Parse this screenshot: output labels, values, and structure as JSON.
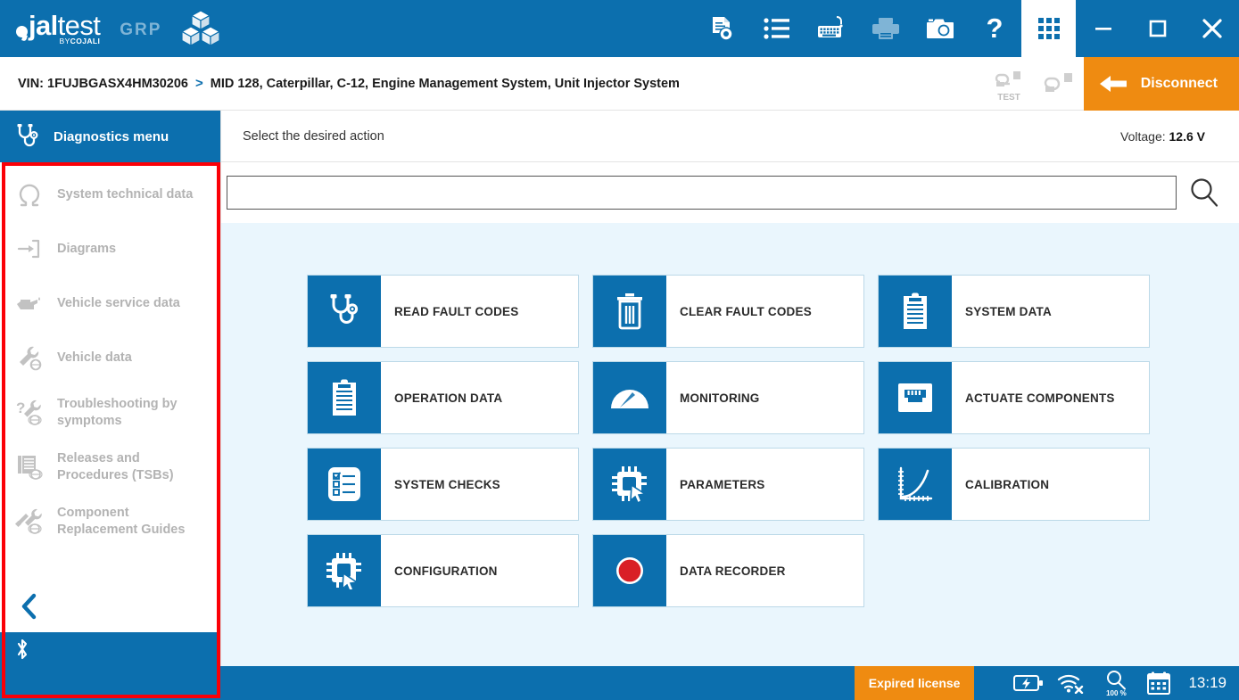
{
  "titlebar": {
    "brand_mark": "jal",
    "brand_rest": "test",
    "brand_sub_pre": "BY",
    "brand_sub_bold": "COJALI",
    "product": "GRP",
    "icons": [
      {
        "name": "document-preview-icon",
        "label": "Reports"
      },
      {
        "name": "list-icon",
        "label": "List"
      },
      {
        "name": "keyboard-icon",
        "label": "Virtual keyboard"
      },
      {
        "name": "printer-icon",
        "label": "Print"
      },
      {
        "name": "camera-icon",
        "label": "Screenshot"
      },
      {
        "name": "help-icon",
        "label": "Help"
      },
      {
        "name": "apps-grid-icon",
        "label": "Applications"
      }
    ],
    "window": {
      "minimize": "minimize",
      "maximize": "maximize",
      "close": "close"
    }
  },
  "breadcrumb": {
    "vin": "VIN: 1FUJBGASX4HM30206",
    "separator": ">",
    "system": "MID 128, Caterpillar, C-12, Engine Management System, Unit Injector System",
    "test_icon_label": "TEST",
    "disconnect_label": "Disconnect"
  },
  "sidebar": {
    "header": "Diagnostics menu",
    "items": [
      {
        "label": "System technical data",
        "icon": "omega-icon"
      },
      {
        "label": "Diagrams",
        "icon": "diagram-icon"
      },
      {
        "label": "Vehicle service data",
        "icon": "oil-can-icon"
      },
      {
        "label": "Vehicle data",
        "icon": "wrench-globe-icon"
      },
      {
        "label": "Troubleshooting by symptoms",
        "icon": "question-wrench-icon"
      },
      {
        "label": "Releases and Procedures (TSBs)",
        "icon": "documents-globe-icon"
      },
      {
        "label": "Component Replacement Guides",
        "icon": "tools-globe-icon"
      }
    ],
    "back_icon": "chevron-left-icon",
    "bluetooth_icon": "bluetooth-icon"
  },
  "main": {
    "hint": "Select the desired action",
    "voltage_label": "Voltage:",
    "voltage_value": "12.6 V",
    "search": {
      "value": "",
      "placeholder": "",
      "icon": "search-icon"
    },
    "tiles": [
      {
        "label": "READ FAULT CODES",
        "icon": "stethoscope-icon"
      },
      {
        "label": "CLEAR FAULT CODES",
        "icon": "trash-icon"
      },
      {
        "label": "SYSTEM DATA",
        "icon": "clipboard-icon"
      },
      {
        "label": "OPERATION DATA",
        "icon": "clipboard-icon"
      },
      {
        "label": "MONITORING",
        "icon": "gauge-icon"
      },
      {
        "label": "ACTUATE COMPONENTS",
        "icon": "ethernet-port-icon"
      },
      {
        "label": "SYSTEM CHECKS",
        "icon": "checklist-icon"
      },
      {
        "label": "PARAMETERS",
        "icon": "chip-cursor-icon"
      },
      {
        "label": "CALIBRATION",
        "icon": "calibration-graph-icon"
      },
      {
        "label": "CONFIGURATION",
        "icon": "chip-cursor-icon"
      },
      {
        "label": "DATA RECORDER",
        "icon": "record-circle-icon"
      }
    ]
  },
  "statusbar": {
    "license": "Expired license",
    "battery_icon": "battery-charging-icon",
    "wifi_icon": "wifi-off-icon",
    "zoom_icon": "zoom-icon",
    "zoom_value": "100 %",
    "calendar_icon": "calendar-icon",
    "time": "13:19"
  },
  "colors": {
    "brand_blue": "#0c6fae",
    "accent_orange": "#ef8b11",
    "content_bg": "#eaf6fd",
    "annotation_red": "#fb0007",
    "record_red": "#d91f26",
    "disabled_grey": "#b3b3b3"
  }
}
